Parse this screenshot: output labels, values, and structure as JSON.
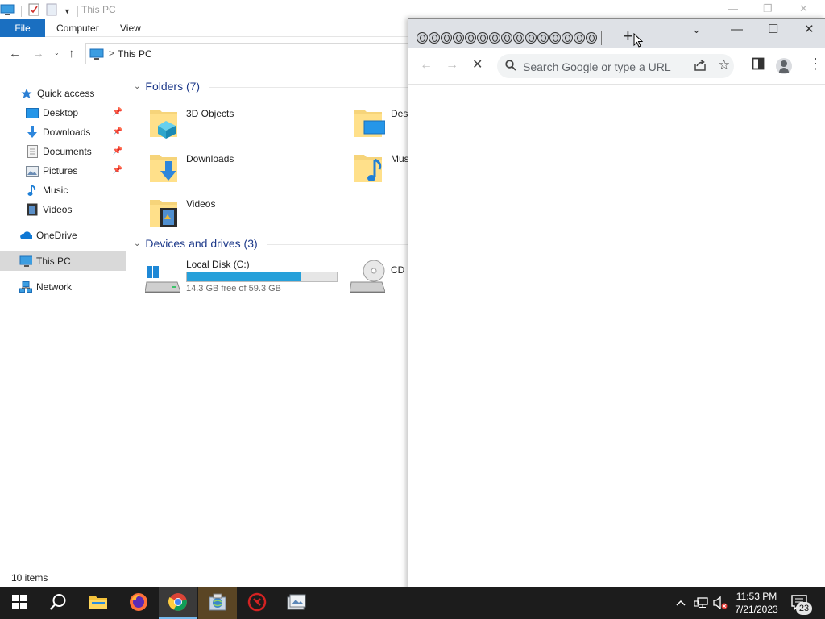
{
  "explorer": {
    "title": "This PC",
    "ribbon_tabs": [
      "File",
      "Computer",
      "View"
    ],
    "address": {
      "crumb": "This PC",
      "separator": ">"
    },
    "nav": {
      "quick_access": "Quick access",
      "items": [
        {
          "label": "Desktop",
          "icon": "desktop-icon",
          "pinned": true
        },
        {
          "label": "Downloads",
          "icon": "downloads-icon",
          "pinned": true
        },
        {
          "label": "Documents",
          "icon": "documents-icon",
          "pinned": true
        },
        {
          "label": "Pictures",
          "icon": "pictures-icon",
          "pinned": true
        },
        {
          "label": "Music",
          "icon": "music-icon",
          "pinned": false
        },
        {
          "label": "Videos",
          "icon": "videos-icon",
          "pinned": false
        }
      ],
      "onedrive": "OneDrive",
      "this_pc": "This PC",
      "network": "Network"
    },
    "folders_header": "Folders (7)",
    "folders": [
      {
        "label": "3D Objects",
        "icon": "3d-objects-icon"
      },
      {
        "label": "Desk",
        "icon": "desktop-folder-icon"
      },
      {
        "label": "Downloads",
        "icon": "downloads-folder-icon"
      },
      {
        "label": "Mus",
        "icon": "music-folder-icon"
      },
      {
        "label": "Videos",
        "icon": "videos-folder-icon"
      }
    ],
    "devices_header": "Devices and drives (3)",
    "drives": [
      {
        "label": "Local Disk (C:)",
        "free_text": "14.3 GB free of 59.3 GB",
        "used_fraction": 0.76
      },
      {
        "label": "CD D",
        "icon": "cd-drive-icon"
      }
    ],
    "status": "10 items"
  },
  "chrome": {
    "tab_count_icons": 15,
    "new_tab": "+",
    "omnibox_placeholder": "Search Google or type a URL"
  },
  "taskbar": {
    "apps": [
      "start-icon",
      "search-icon",
      "file-explorer-icon",
      "firefox-icon",
      "chrome-icon",
      "app-globe-icon",
      "app-red-icon",
      "app-image-icon"
    ],
    "time": "11:53 PM",
    "date": "7/21/2023",
    "notifications": "23"
  },
  "colors": {
    "accent": "#1a6fc1",
    "progress": "#26a0da",
    "taskbar": "#1c1c1c"
  }
}
